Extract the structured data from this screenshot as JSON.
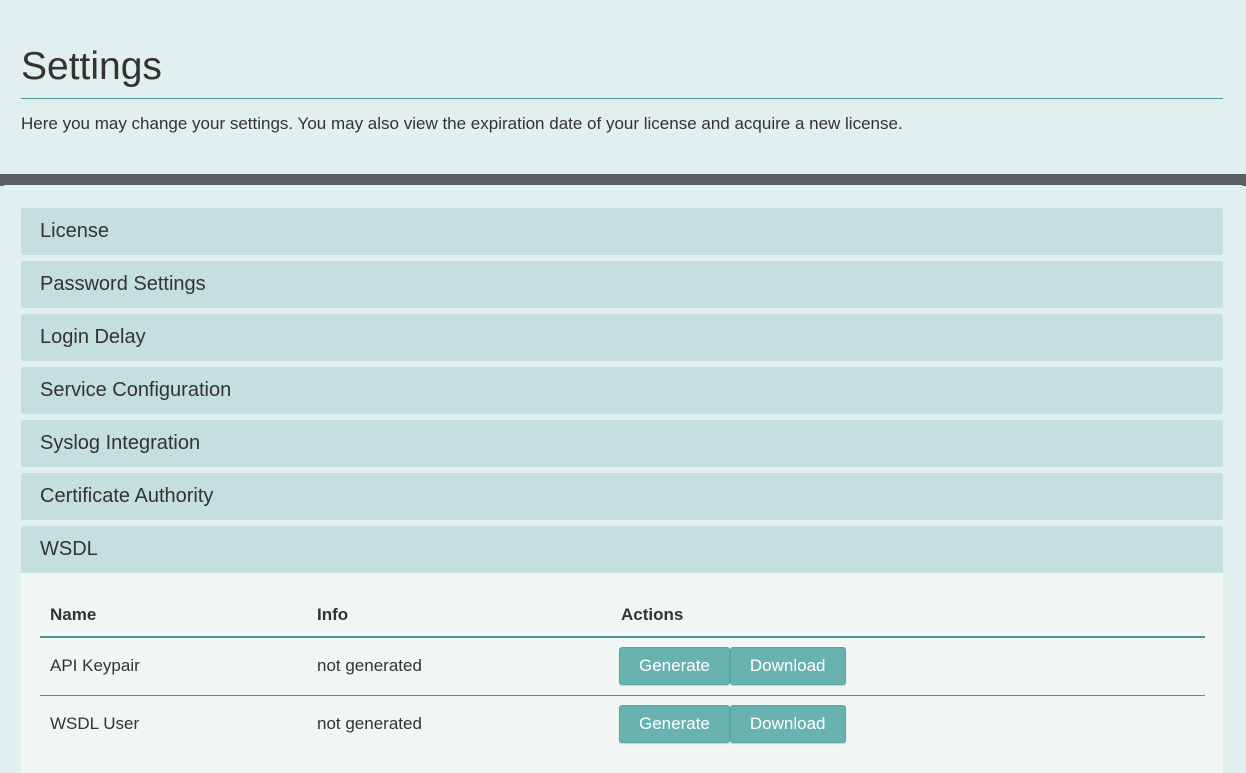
{
  "header": {
    "title": "Settings",
    "description": "Here you may change your settings. You may also view the expiration date of your license and acquire a new license."
  },
  "sections": [
    {
      "label": "License"
    },
    {
      "label": "Password Settings"
    },
    {
      "label": "Login Delay"
    },
    {
      "label": "Service Configuration"
    },
    {
      "label": "Syslog Integration"
    },
    {
      "label": "Certificate Authority"
    },
    {
      "label": "WSDL"
    }
  ],
  "wsdl_table": {
    "columns": [
      "Name",
      "Info",
      "Actions"
    ],
    "rows": [
      {
        "name": "API Keypair",
        "info": "not generated",
        "generate": "Generate",
        "download": "Download"
      },
      {
        "name": "WSDL User",
        "info": "not generated",
        "generate": "Generate",
        "download": "Download"
      }
    ]
  },
  "colors": {
    "background": "#e1efee",
    "accordion_header": "#c4dfdd",
    "accent": "#4b9693",
    "button": "#68b3b0",
    "band": "#5c5f5f"
  }
}
